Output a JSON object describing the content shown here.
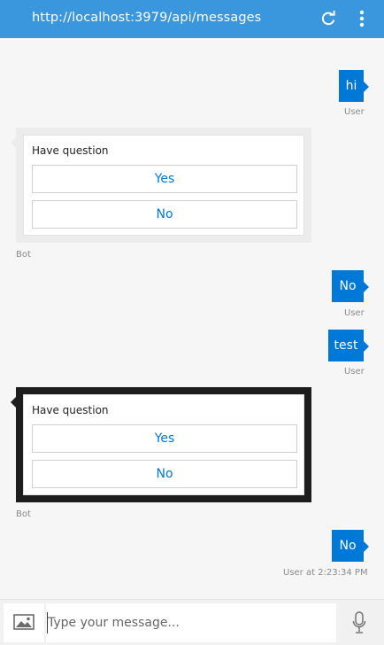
{
  "header": {
    "url": "http://localhost:3979/api/messages",
    "refresh_icon": "refresh-icon",
    "more_icon": "more-vertical-icon",
    "bg_color": "#3a96dd"
  },
  "messages": [
    {
      "type": "user",
      "text": "hi",
      "from": "User"
    },
    {
      "type": "card",
      "question": "Have question",
      "buttons": [
        "Yes",
        "No"
      ],
      "from": "Bot"
    },
    {
      "type": "user",
      "text": "No",
      "from": "User"
    },
    {
      "type": "user",
      "text": "test",
      "from": "User"
    },
    {
      "type": "card",
      "question": "Have question",
      "buttons": [
        "Yes",
        "No"
      ],
      "from": "Bot"
    },
    {
      "type": "user",
      "text": "No",
      "from": "User at 2:23:34 PM"
    }
  ],
  "input": {
    "placeholder": "Type your message...",
    "value": "",
    "upload_icon": "image-upload-icon",
    "mic_icon": "microphone-icon"
  },
  "colors": {
    "accent": "#0078d7",
    "card_border": "#ececec",
    "card_selected_border": "#1d1d1d"
  }
}
